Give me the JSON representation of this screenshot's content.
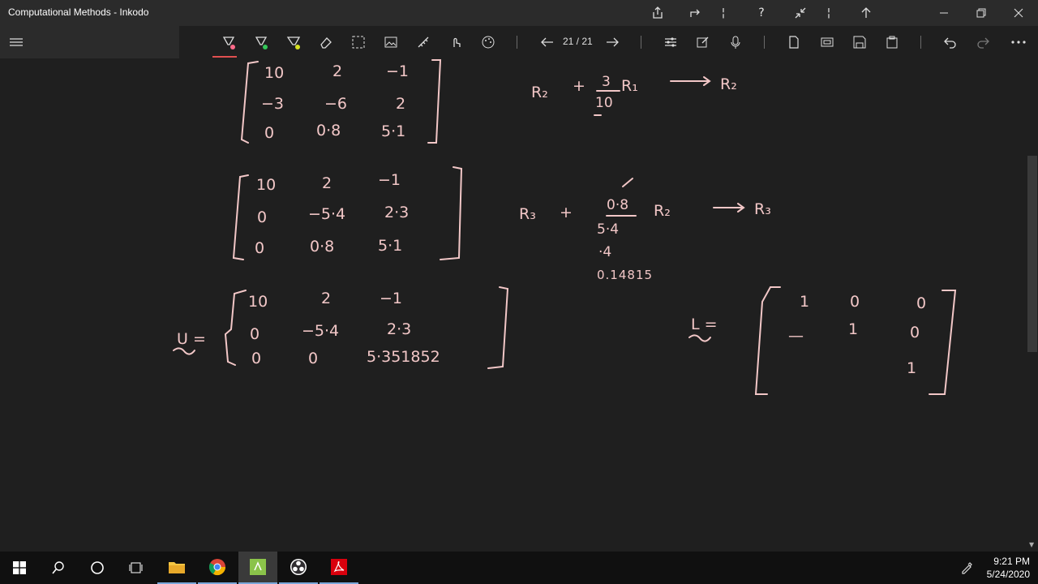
{
  "window": {
    "title": "Computational Methods - Inkodo"
  },
  "titlebar_icons": [
    "share-icon",
    "share-arrow-icon",
    "help-icon",
    "collapse-icon",
    "up-arrow-icon",
    "minimize-icon",
    "restore-icon",
    "close-icon"
  ],
  "toolbar": {
    "page_indicator": "21 / 21",
    "pen_colors": {
      "pen1": "#ff6b8a",
      "pen2": "#34c759",
      "pen3": "#d6e021"
    }
  },
  "ink": {
    "matrix1": {
      "rows": [
        [
          "10",
          "2",
          "−1"
        ],
        [
          "−3",
          "−6",
          "2"
        ],
        [
          "0",
          "0·8",
          "5·1"
        ]
      ]
    },
    "op1": {
      "lhs": "R₂",
      "plus": "+",
      "num": "3",
      "den": "10",
      "r": "R₁",
      "rhs": "R₂"
    },
    "matrix2": {
      "rows": [
        [
          "10",
          "2",
          "−1"
        ],
        [
          "0",
          "−5·4",
          "2·3"
        ],
        [
          "0",
          "0·8",
          "5·1"
        ]
      ]
    },
    "op2": {
      "lhs": "R₃",
      "plus": "+",
      "num": "0·8",
      "den": "5·4",
      "r": "R₂",
      "rhs": "R₃",
      "note1": "·4",
      "note2": "0.14815"
    },
    "matrixU": {
      "label": "U =",
      "rows": [
        [
          "10",
          "2",
          "−1"
        ],
        [
          "0",
          "−5·4",
          "2·3"
        ],
        [
          "0",
          "0",
          "5·351852"
        ]
      ]
    },
    "matrixL": {
      "label": "L =",
      "rows": [
        [
          "1",
          "0",
          "0"
        ],
        [
          "—",
          "1",
          "0"
        ],
        [
          "",
          "",
          "1"
        ]
      ]
    }
  },
  "taskbar": {
    "apps": [
      "windows-start-icon",
      "search-icon",
      "cortana-icon",
      "task-view-icon",
      "file-explorer-icon",
      "chrome-icon",
      "inkodo-icon",
      "obs-icon",
      "acrobat-icon"
    ],
    "time": "9:21 PM",
    "date": "5/24/2020"
  },
  "colors": {
    "ink": "#f2c7c7",
    "background": "#1f1f1f",
    "titlebar": "#2b2b2b",
    "taskbar": "#101010"
  }
}
